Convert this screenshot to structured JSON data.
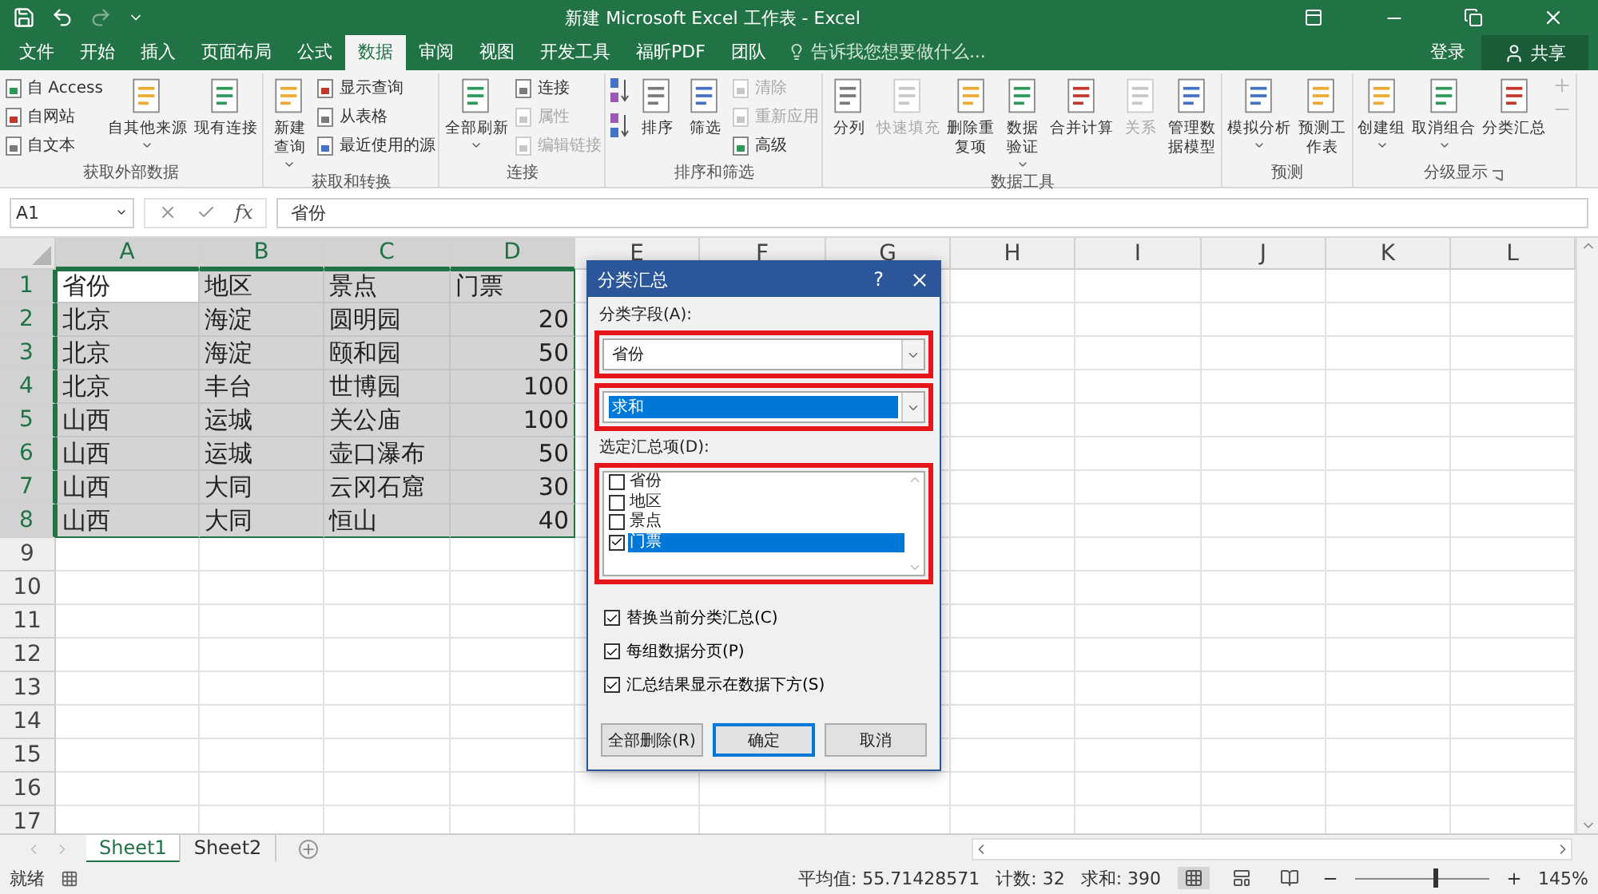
{
  "window": {
    "title": "新建 Microsoft Excel 工作表 - Excel"
  },
  "menu_tabs": [
    {
      "label": "文件",
      "selected": false
    },
    {
      "label": "开始",
      "selected": false
    },
    {
      "label": "插入",
      "selected": false
    },
    {
      "label": "页面布局",
      "selected": false
    },
    {
      "label": "公式",
      "selected": false
    },
    {
      "label": "数据",
      "selected": true
    },
    {
      "label": "审阅",
      "selected": false
    },
    {
      "label": "视图",
      "selected": false
    },
    {
      "label": "开发工具",
      "selected": false
    },
    {
      "label": "福昕PDF",
      "selected": false
    },
    {
      "label": "团队",
      "selected": false
    }
  ],
  "tell_me": {
    "placeholder": "告诉我您想要做什么..."
  },
  "account": {
    "sign_in": "登录",
    "share": "共享"
  },
  "ribbon": {
    "groups": [
      {
        "label": "获取外部数据",
        "launcher": false,
        "items": [
          {
            "kind": "stack",
            "entries": [
              {
                "label": "自 Access",
                "disabled": false
              },
              {
                "label": "自网站",
                "disabled": false
              },
              {
                "label": "自文本",
                "disabled": false
              }
            ]
          },
          {
            "kind": "large",
            "label": "自其他来源",
            "dropdown": true,
            "disabled": false
          },
          {
            "kind": "large",
            "label": "现有连接",
            "dropdown": false,
            "disabled": false
          }
        ]
      },
      {
        "label": "获取和转换",
        "launcher": false,
        "items": [
          {
            "kind": "large",
            "label": "新建查询",
            "two_line": true,
            "dropdown": true,
            "disabled": false
          },
          {
            "kind": "stack",
            "entries": [
              {
                "label": "显示查询",
                "disabled": false
              },
              {
                "label": "从表格",
                "disabled": false
              },
              {
                "label": "最近使用的源",
                "disabled": false
              }
            ]
          }
        ]
      },
      {
        "label": "连接",
        "launcher": false,
        "items": [
          {
            "kind": "large",
            "label": "全部刷新",
            "dropdown": true,
            "disabled": false
          },
          {
            "kind": "stack",
            "entries": [
              {
                "label": "连接",
                "disabled": false
              },
              {
                "label": "属性",
                "disabled": true
              },
              {
                "label": "编辑链接",
                "disabled": true
              }
            ]
          }
        ]
      },
      {
        "label": "排序和筛选",
        "launcher": false,
        "items": [
          {
            "kind": "sort-icons"
          },
          {
            "kind": "large",
            "label": "排序",
            "dropdown": false,
            "disabled": false
          },
          {
            "kind": "large",
            "label": "筛选",
            "dropdown": false,
            "disabled": false
          },
          {
            "kind": "stack",
            "entries": [
              {
                "label": "清除",
                "disabled": true
              },
              {
                "label": "重新应用",
                "disabled": true
              },
              {
                "label": "高级",
                "disabled": false
              }
            ]
          }
        ]
      },
      {
        "label": "数据工具",
        "launcher": false,
        "items": [
          {
            "kind": "large",
            "label": "分列",
            "dropdown": false,
            "disabled": false
          },
          {
            "kind": "large",
            "label": "快速填充",
            "dropdown": false,
            "disabled": true
          },
          {
            "kind": "large",
            "label": "删除重复项",
            "two_line": true,
            "dropdown": false,
            "disabled": false
          },
          {
            "kind": "large",
            "label": "数据验证",
            "two_line": true,
            "dropdown": true,
            "disabled": false
          },
          {
            "kind": "large",
            "label": "合并计算",
            "dropdown": false,
            "disabled": false
          },
          {
            "kind": "large",
            "label": "关系",
            "dropdown": false,
            "disabled": true
          },
          {
            "kind": "large",
            "label": "管理数据模型",
            "two_line": true,
            "dropdown": false,
            "disabled": false
          }
        ]
      },
      {
        "label": "预测",
        "launcher": false,
        "items": [
          {
            "kind": "large",
            "label": "模拟分析",
            "dropdown": true,
            "disabled": false
          },
          {
            "kind": "large",
            "label": "预测工作表",
            "two_line": true,
            "dropdown": false,
            "disabled": false
          }
        ]
      },
      {
        "label": "分级显示",
        "launcher": true,
        "items": [
          {
            "kind": "large",
            "label": "创建组",
            "dropdown": true,
            "disabled": false
          },
          {
            "kind": "large",
            "label": "取消组合",
            "dropdown": true,
            "disabled": false
          },
          {
            "kind": "large",
            "label": "分类汇总",
            "dropdown": false,
            "disabled": false
          },
          {
            "kind": "outline-icons"
          }
        ]
      }
    ]
  },
  "formula_bar": {
    "name_box": "A1",
    "function_label": "fx",
    "value": "省份"
  },
  "sheet": {
    "columns": [
      {
        "label": "A",
        "selected": true,
        "numeric": false
      },
      {
        "label": "B",
        "selected": true,
        "numeric": false
      },
      {
        "label": "C",
        "selected": true,
        "numeric": false
      },
      {
        "label": "D",
        "selected": true,
        "numeric": true
      },
      {
        "label": "E",
        "selected": false
      },
      {
        "label": "F",
        "selected": false
      },
      {
        "label": "G",
        "selected": false
      },
      {
        "label": "H",
        "selected": false
      },
      {
        "label": "I",
        "selected": false
      },
      {
        "label": "J",
        "selected": false
      },
      {
        "label": "K",
        "selected": false
      },
      {
        "label": "L",
        "selected": false
      }
    ],
    "row_numbers": [
      {
        "label": "1",
        "selected": true
      },
      {
        "label": "2",
        "selected": true
      },
      {
        "label": "3",
        "selected": true
      },
      {
        "label": "4",
        "selected": true
      },
      {
        "label": "5",
        "selected": true
      },
      {
        "label": "6",
        "selected": true
      },
      {
        "label": "7",
        "selected": true
      },
      {
        "label": "8",
        "selected": true
      },
      {
        "label": "9",
        "selected": false
      },
      {
        "label": "10",
        "selected": false
      },
      {
        "label": "11",
        "selected": false
      },
      {
        "label": "12",
        "selected": false
      },
      {
        "label": "13",
        "selected": false
      },
      {
        "label": "14",
        "selected": false
      },
      {
        "label": "15",
        "selected": false
      },
      {
        "label": "16",
        "selected": false
      },
      {
        "label": "17",
        "selected": false
      }
    ],
    "rows": [
      {
        "kind": "header",
        "cells": [
          "省份",
          "地区",
          "景点",
          "门票"
        ]
      },
      {
        "kind": "data",
        "cells": [
          "北京",
          "海淀",
          "圆明园",
          "20"
        ]
      },
      {
        "kind": "data",
        "cells": [
          "北京",
          "海淀",
          "颐和园",
          "50"
        ]
      },
      {
        "kind": "data",
        "cells": [
          "北京",
          "丰台",
          "世博园",
          "100"
        ]
      },
      {
        "kind": "data",
        "cells": [
          "山西",
          "运城",
          "关公庙",
          "100"
        ]
      },
      {
        "kind": "data",
        "cells": [
          "山西",
          "运城",
          "壶口瀑布",
          "50"
        ]
      },
      {
        "kind": "data",
        "cells": [
          "山西",
          "大同",
          "云冈石窟",
          "30"
        ]
      },
      {
        "kind": "data",
        "cells": [
          "山西",
          "大同",
          "恒山",
          "40"
        ]
      }
    ]
  },
  "dialog": {
    "title": "分类汇总",
    "help": "?",
    "group_by": {
      "label": "分类字段(A):",
      "value": "省份"
    },
    "function": {
      "value": "求和",
      "selected": true
    },
    "items": {
      "label": "选定汇总项(D):",
      "options": [
        {
          "label": "省份",
          "checked": false,
          "selected": false
        },
        {
          "label": "地区",
          "checked": false,
          "selected": false
        },
        {
          "label": "景点",
          "checked": false,
          "selected": false
        },
        {
          "label": "门票",
          "checked": true,
          "selected": true
        }
      ]
    },
    "settings": [
      {
        "label": "替换当前分类汇总(C)",
        "checked": true
      },
      {
        "label": "每组数据分页(P)",
        "checked": true
      },
      {
        "label": "汇总结果显示在数据下方(S)",
        "checked": true
      }
    ],
    "buttons": [
      {
        "label": "全部删除(R)",
        "default": false
      },
      {
        "label": "确定",
        "default": true
      },
      {
        "label": "取消",
        "default": false
      }
    ]
  },
  "sheet_tabs": [
    {
      "label": "Sheet1",
      "selected": true
    },
    {
      "label": "Sheet2",
      "selected": false
    }
  ],
  "status_bar": {
    "ready": "就绪",
    "average": "平均值: 55.71428571",
    "count": "计数: 32",
    "sum": "求和: 390",
    "zoom_slider": {
      "level": 0.6
    },
    "zoom": "145%"
  }
}
